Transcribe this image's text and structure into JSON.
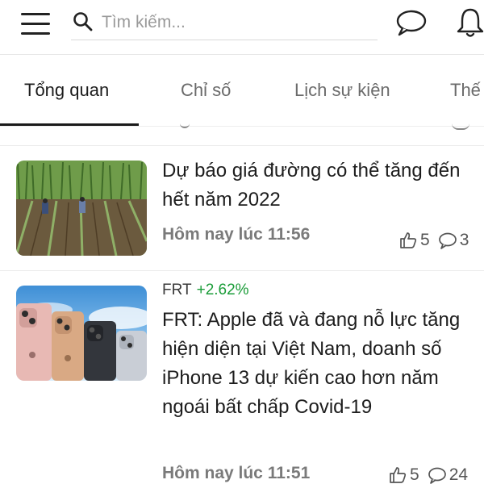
{
  "search": {
    "placeholder": "Tìm kiếm..."
  },
  "tabs": [
    {
      "label": "Tổng quan"
    },
    {
      "label": "Chỉ số"
    },
    {
      "label": "Lịch sự kiện"
    },
    {
      "label": "Thế"
    }
  ],
  "articles": [
    {
      "title": "Dự báo giá đường có thể tăng đến hết năm 2022",
      "time": "Hôm nay lúc 11:56",
      "likes": "5",
      "comments": "3",
      "image": "sugarcane-field"
    },
    {
      "ticker": "FRT",
      "change": "+2.62%",
      "title": "FRT: Apple đã và đang nỗ lực tăng hiện diện tại Việt Nam, doanh số iPhone 13 dự kiến cao hơn năm ngoái bất chấp Covid-19",
      "time": "Hôm nay lúc 11:51",
      "likes": "5",
      "comments": "24",
      "image": "iphone-lineup"
    }
  ],
  "colors": {
    "accent_positive": "#1a9c38",
    "tab_indicator": "#1a1a1a"
  },
  "icons": [
    "menu-icon",
    "search-icon",
    "chat-icon",
    "bell-icon",
    "thumbs-up-icon",
    "comment-icon"
  ]
}
